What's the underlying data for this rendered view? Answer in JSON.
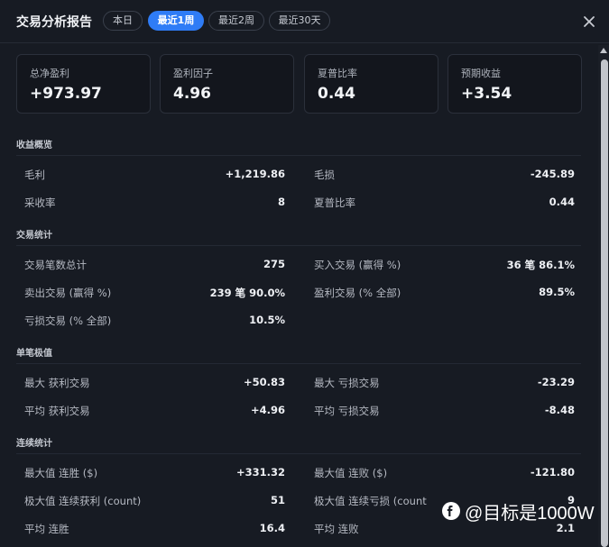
{
  "header": {
    "title": "交易分析报告",
    "tabs": [
      "本日",
      "最近1周",
      "最近2周",
      "最近30天"
    ],
    "active_tab": "最近1周"
  },
  "cards": [
    {
      "label": "总净盈利",
      "value": "+973.97"
    },
    {
      "label": "盈利因子",
      "value": "4.96"
    },
    {
      "label": "夏普比率",
      "value": "0.44"
    },
    {
      "label": "预期收益",
      "value": "+3.54"
    }
  ],
  "sections": {
    "overview": {
      "title": "收益概览",
      "rows": [
        {
          "l_label": "毛利",
          "l_value": "+1,219.86",
          "r_label": "毛损",
          "r_value": "-245.89"
        },
        {
          "l_label": "采收率",
          "l_value": "8",
          "r_label": "夏普比率",
          "r_value": "0.44"
        }
      ]
    },
    "trade_stats": {
      "title": "交易统计",
      "rows": [
        {
          "l_label": "交易笔数总计",
          "l_value": "275",
          "r_label": "买入交易 (赢得 %)",
          "r_value": "36 笔  86.1%"
        },
        {
          "l_label": "卖出交易 (赢得 %)",
          "l_value": "239 笔  90.0%",
          "r_label": "盈利交易 (% 全部)",
          "r_value": "89.5%"
        },
        {
          "l_label": "亏损交易 (% 全部)",
          "l_value": "10.5%"
        }
      ]
    },
    "extremes": {
      "title": "单笔极值",
      "rows": [
        {
          "l_label": "最大 获利交易",
          "l_value": "+50.83",
          "r_label": "最大 亏损交易",
          "r_value": "-23.29"
        },
        {
          "l_label": "平均 获利交易",
          "l_value": "+4.96",
          "r_label": "平均 亏损交易",
          "r_value": "-8.48"
        }
      ]
    },
    "streaks": {
      "title": "连续统计",
      "rows": [
        {
          "l_label": "最大值 连胜 ($)",
          "l_value": "+331.32",
          "r_label": "最大值 连败 ($)",
          "r_value": "-121.80"
        },
        {
          "l_label": "极大值 连续获利 (count)",
          "l_value": "51",
          "r_label": "极大值 连续亏损 (count",
          "r_value": "9"
        },
        {
          "l_label": "平均 连胜",
          "l_value": "16.4",
          "r_label": "平均 连败",
          "r_value": "2.1"
        }
      ]
    }
  },
  "watermark": {
    "text": "@目标是1000W",
    "icon": "weibo-logo-icon"
  },
  "colors": {
    "accent": "#2f7cf6",
    "background": "#171b23",
    "card": "#13161d"
  }
}
